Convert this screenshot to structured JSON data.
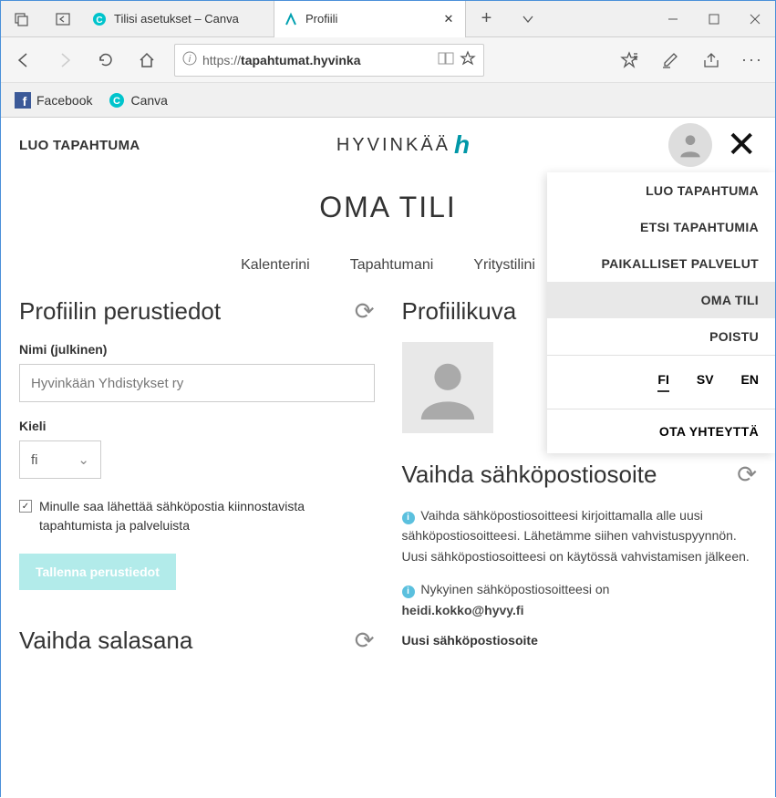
{
  "browser": {
    "tabs": [
      {
        "title": "Tilisi asetukset – Canva",
        "favicon_color": "#00c4cc"
      },
      {
        "title": "Profiili",
        "favicon_color": "#00a0b0"
      }
    ],
    "url_prefix": "https://",
    "url_bold": "tapahtumat.hyvinka",
    "bookmarks": [
      {
        "label": "Facebook"
      },
      {
        "label": "Canva"
      }
    ]
  },
  "header": {
    "create_event": "LUO TAPAHTUMA",
    "logo_text": "HYVINKÄÄ"
  },
  "page_title": "OMA TILI",
  "tabs": [
    "Kalenterini",
    "Tapahtumani",
    "Yritystilini"
  ],
  "profile": {
    "section_title": "Profiilin perustiedot",
    "name_label": "Nimi (julkinen)",
    "name_value": "Hyvinkään Yhdistykset ry",
    "lang_label": "Kieli",
    "lang_value": "fi",
    "checkbox_label": "Minulle saa lähettää sähköpostia kiinnostavista tapahtumista ja palveluista",
    "save_button": "Tallenna perustiedot",
    "change_password_title": "Vaihda salasana"
  },
  "picture": {
    "section_title": "Profiilikuva"
  },
  "email": {
    "section_title": "Vaihda sähköpostiosoite",
    "info_text": "Vaihda sähköpostiosoitteesi kirjoittamalla alle uusi sähköpostiosoitteesi. Lähetämme siihen vahvistuspyynnön. Uusi sähköpostiosoitteesi on käytössä vahvistamisen jälkeen.",
    "current_label": "Nykyinen sähköpostiosoitteesi on",
    "current_value": "heidi.kokko@hyvy.fi",
    "new_label": "Uusi sähköpostiosoite"
  },
  "menu": {
    "items": [
      {
        "label": "LUO TAPAHTUMA",
        "active": false
      },
      {
        "label": "ETSI TAPAHTUMIA",
        "active": false
      },
      {
        "label": "PAIKALLISET PALVELUT",
        "active": false
      },
      {
        "label": "OMA TILI",
        "active": true
      },
      {
        "label": "POISTU",
        "active": false
      }
    ],
    "langs": [
      "FI",
      "SV",
      "EN"
    ],
    "lang_active": "FI",
    "contact": "OTA YHTEYTTÄ"
  }
}
